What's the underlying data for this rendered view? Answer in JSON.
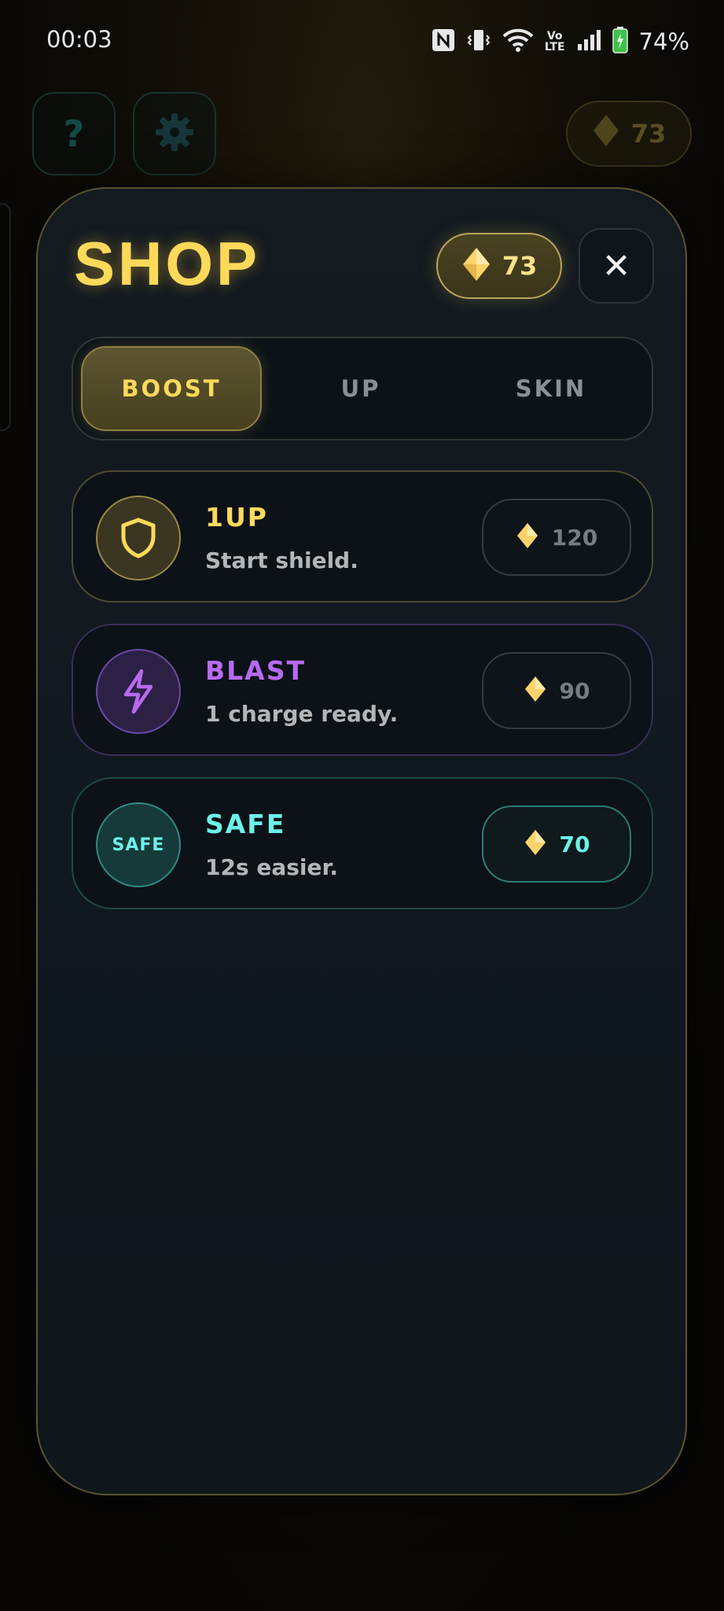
{
  "status_bar": {
    "time": "00:03",
    "battery": "74%",
    "icons": [
      "nfc-icon",
      "vibrate-icon",
      "wifi-icon",
      "volte-icon",
      "signal-icon",
      "battery-charging-icon"
    ],
    "volte_line1": "Vo",
    "volte_line2": "LTE"
  },
  "hud": {
    "help_label": "?",
    "gems_count": "73"
  },
  "shop": {
    "title": "SHOP",
    "gems_count": "73",
    "close_label": "✕",
    "tabs": [
      {
        "label": "BOOST",
        "selected": true
      },
      {
        "label": "UP",
        "selected": false
      },
      {
        "label": "SKIN",
        "selected": false
      }
    ],
    "items": [
      {
        "name": "1UP",
        "desc": "Start shield.",
        "price": "120",
        "icon": "shield-icon",
        "color": "#ffd95a"
      },
      {
        "name": "BLAST",
        "desc": "1 charge ready.",
        "price": "90",
        "icon": "lightning-icon",
        "color": "#b76af0"
      },
      {
        "name": "SAFE",
        "desc": "12s easier.",
        "price": "70",
        "icon": "safe-badge-icon",
        "icon_text": "SAFE",
        "color": "#6df2ea"
      }
    ]
  },
  "colors": {
    "gold": "#ffd95a",
    "purple": "#b76af0",
    "cyan": "#6df2ea",
    "gem": "#ffd36b"
  }
}
